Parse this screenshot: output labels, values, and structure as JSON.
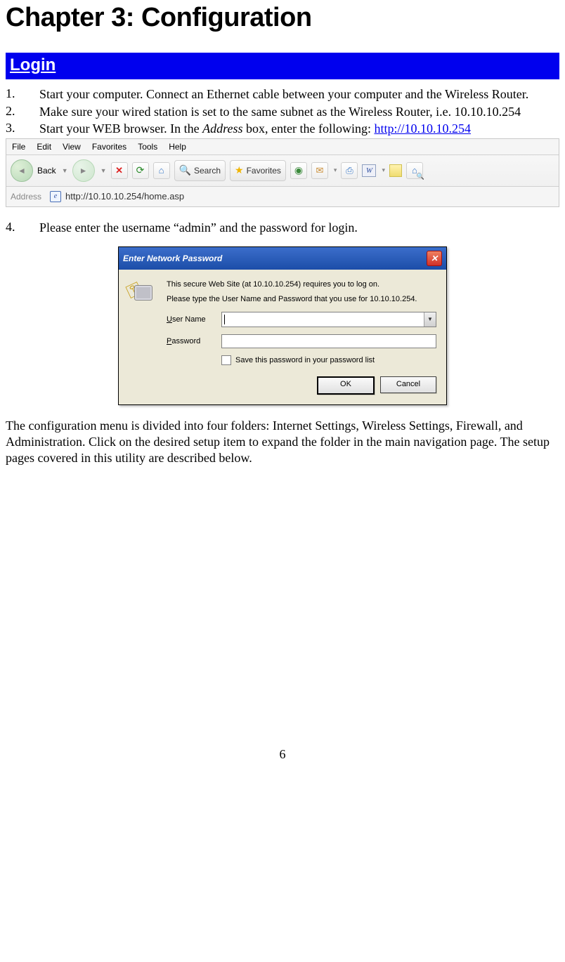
{
  "chapter_title": "Chapter 3: Configuration",
  "section_heading": "Login",
  "steps": [
    {
      "num": "1.",
      "text": "Start your computer. Connect an Ethernet cable between your computer and the Wireless Router."
    },
    {
      "num": "2.",
      "text": "Make sure your wired station is set to the same subnet as the Wireless  Router, i.e. 10.10.10.254"
    },
    {
      "num": "3.",
      "text_a": "Start your WEB browser. In the ",
      "italic": "Address",
      "text_b": " box, enter the following: ",
      "link": "http://10.10.10.254"
    },
    {
      "num": "4.",
      "text": "Please enter the username “admin” and the password for login."
    }
  ],
  "browser": {
    "menu": [
      "File",
      "Edit",
      "View",
      "Favorites",
      "Tools",
      "Help"
    ],
    "back_label": "Back",
    "search_label": "Search",
    "favorites_label": "Favorites",
    "address_label": "Address",
    "address_value": "http://10.10.10.254/home.asp"
  },
  "dialog": {
    "title": "Enter Network Password",
    "line1": "This secure Web Site (at 10.10.10.254) requires you to log on.",
    "line2": "Please type the User Name and Password that you use for 10.10.10.254.",
    "user_u": "U",
    "user_rest": "ser Name",
    "pass_u": "P",
    "pass_rest": "assword",
    "save_u": "S",
    "save_rest": "ave this password in your password list",
    "ok": "OK",
    "cancel": "Cancel"
  },
  "closing_para": "The configuration menu is divided into four folders: Internet Settings, Wireless Settings, Firewall, and Administration. Click on the desired setup item to expand the folder in the main navigation page. The setup pages covered in this utility are described below.",
  "page_number": "6"
}
